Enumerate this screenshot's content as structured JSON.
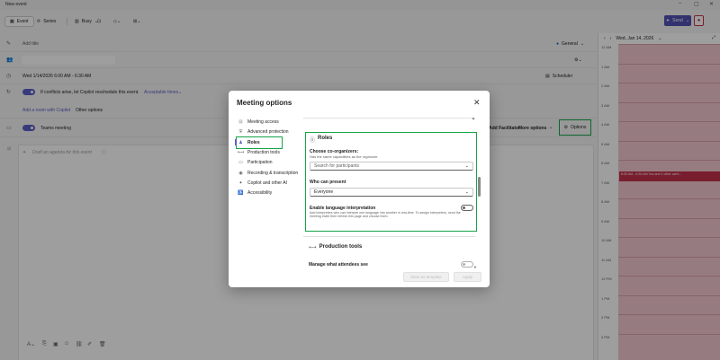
{
  "window": {
    "title": "New event"
  },
  "toolbar": {
    "event_tab": "Event",
    "series_tab": "Series",
    "busy": "Busy",
    "send": "Send"
  },
  "form": {
    "title_placeholder": "Add title",
    "category": "General",
    "datetime": "Wed 1/14/2026 6:00 AM - 6:30 AM",
    "scheduler": "Scheduler",
    "copilot_text": "If conflicts arise, let Copilot reschedule this event.",
    "acceptable_times": "Acceptable times",
    "add_room": "Add a room with Copilot",
    "other_options": "Other options",
    "teams_meeting": "Teams meeting",
    "facilitator": "Add Facilitator",
    "more_options": "More options",
    "options_button": "Options",
    "agenda_placeholder": "Draft an agenda for this event"
  },
  "calendar": {
    "date": "Wed, Jan 14, 2026",
    "hours": [
      "12 AM",
      "1 AM",
      "2 AM",
      "3 AM",
      "4 AM",
      "5 AM",
      "6 AM",
      "7 AM",
      "8 AM",
      "9 AM",
      "10 AM",
      "11 AM",
      "12 PM",
      "1 PM",
      "2 PM",
      "3 PM"
    ],
    "event_text": "6:00 AM - 6:30 AM  You and 1 other can't..."
  },
  "dialog": {
    "title": "Meeting options",
    "nav": [
      {
        "label": "Meeting access",
        "icon": "lock-icon"
      },
      {
        "label": "Advanced protection",
        "icon": "shield-icon"
      },
      {
        "label": "Roles",
        "icon": "person-icon"
      },
      {
        "label": "Production tools",
        "icon": "production-icon"
      },
      {
        "label": "Participation",
        "icon": "chat-icon"
      },
      {
        "label": "Recording & transcription",
        "icon": "record-icon"
      },
      {
        "label": "Copilot and other AI",
        "icon": "copilot-icon"
      },
      {
        "label": "Accessibility",
        "icon": "accessibility-icon"
      }
    ],
    "roles": {
      "heading": "Roles",
      "coorg_label": "Choose co-organizers:",
      "coorg_help": "Has the same capabilities as the organizer.",
      "coorg_placeholder": "Search for participants",
      "present_label": "Who can present",
      "present_value": "Everyone",
      "lang_label": "Enable language interpretation",
      "lang_help": "Add interpreters who can interpret one language into another in real-time. To assign interpreters, send the meeting invite then refresh this page and choose them.",
      "lang_enabled": false
    },
    "production": {
      "heading": "Production tools",
      "manage_label": "Manage what attendees see"
    },
    "save_template": "Save as template",
    "apply": "Apply"
  },
  "colors": {
    "accent": "#5b5fc7",
    "highlight": "#16a34a",
    "calendar_bg": "#f3c9cf",
    "event_red": "#c4314b"
  }
}
